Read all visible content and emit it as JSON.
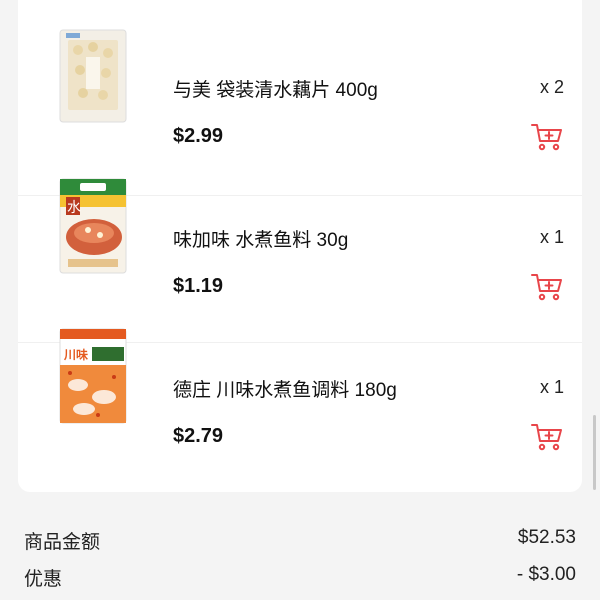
{
  "items": [
    {
      "name": "与美 袋装清水藕片 400g",
      "price": "$2.99",
      "qty": "x 2",
      "image_icon": "lotus-root-package-icon"
    },
    {
      "name": "味加味 水煮鱼料 30g",
      "price": "$1.19",
      "qty": "x 1",
      "image_icon": "fish-seasoning-packet-icon"
    },
    {
      "name": "德庄 川味水煮鱼调料 180g",
      "price": "$2.79",
      "qty": "x 1",
      "image_icon": "sichuan-fish-seasoning-bag-icon"
    }
  ],
  "summary": {
    "subtotal_label": "商品金额",
    "subtotal_value": "$52.53",
    "discount_label": "优惠",
    "discount_value": "- $3.00"
  },
  "colors": {
    "accent": "#e8454a",
    "background": "#f4f4f4",
    "card": "#ffffff"
  }
}
